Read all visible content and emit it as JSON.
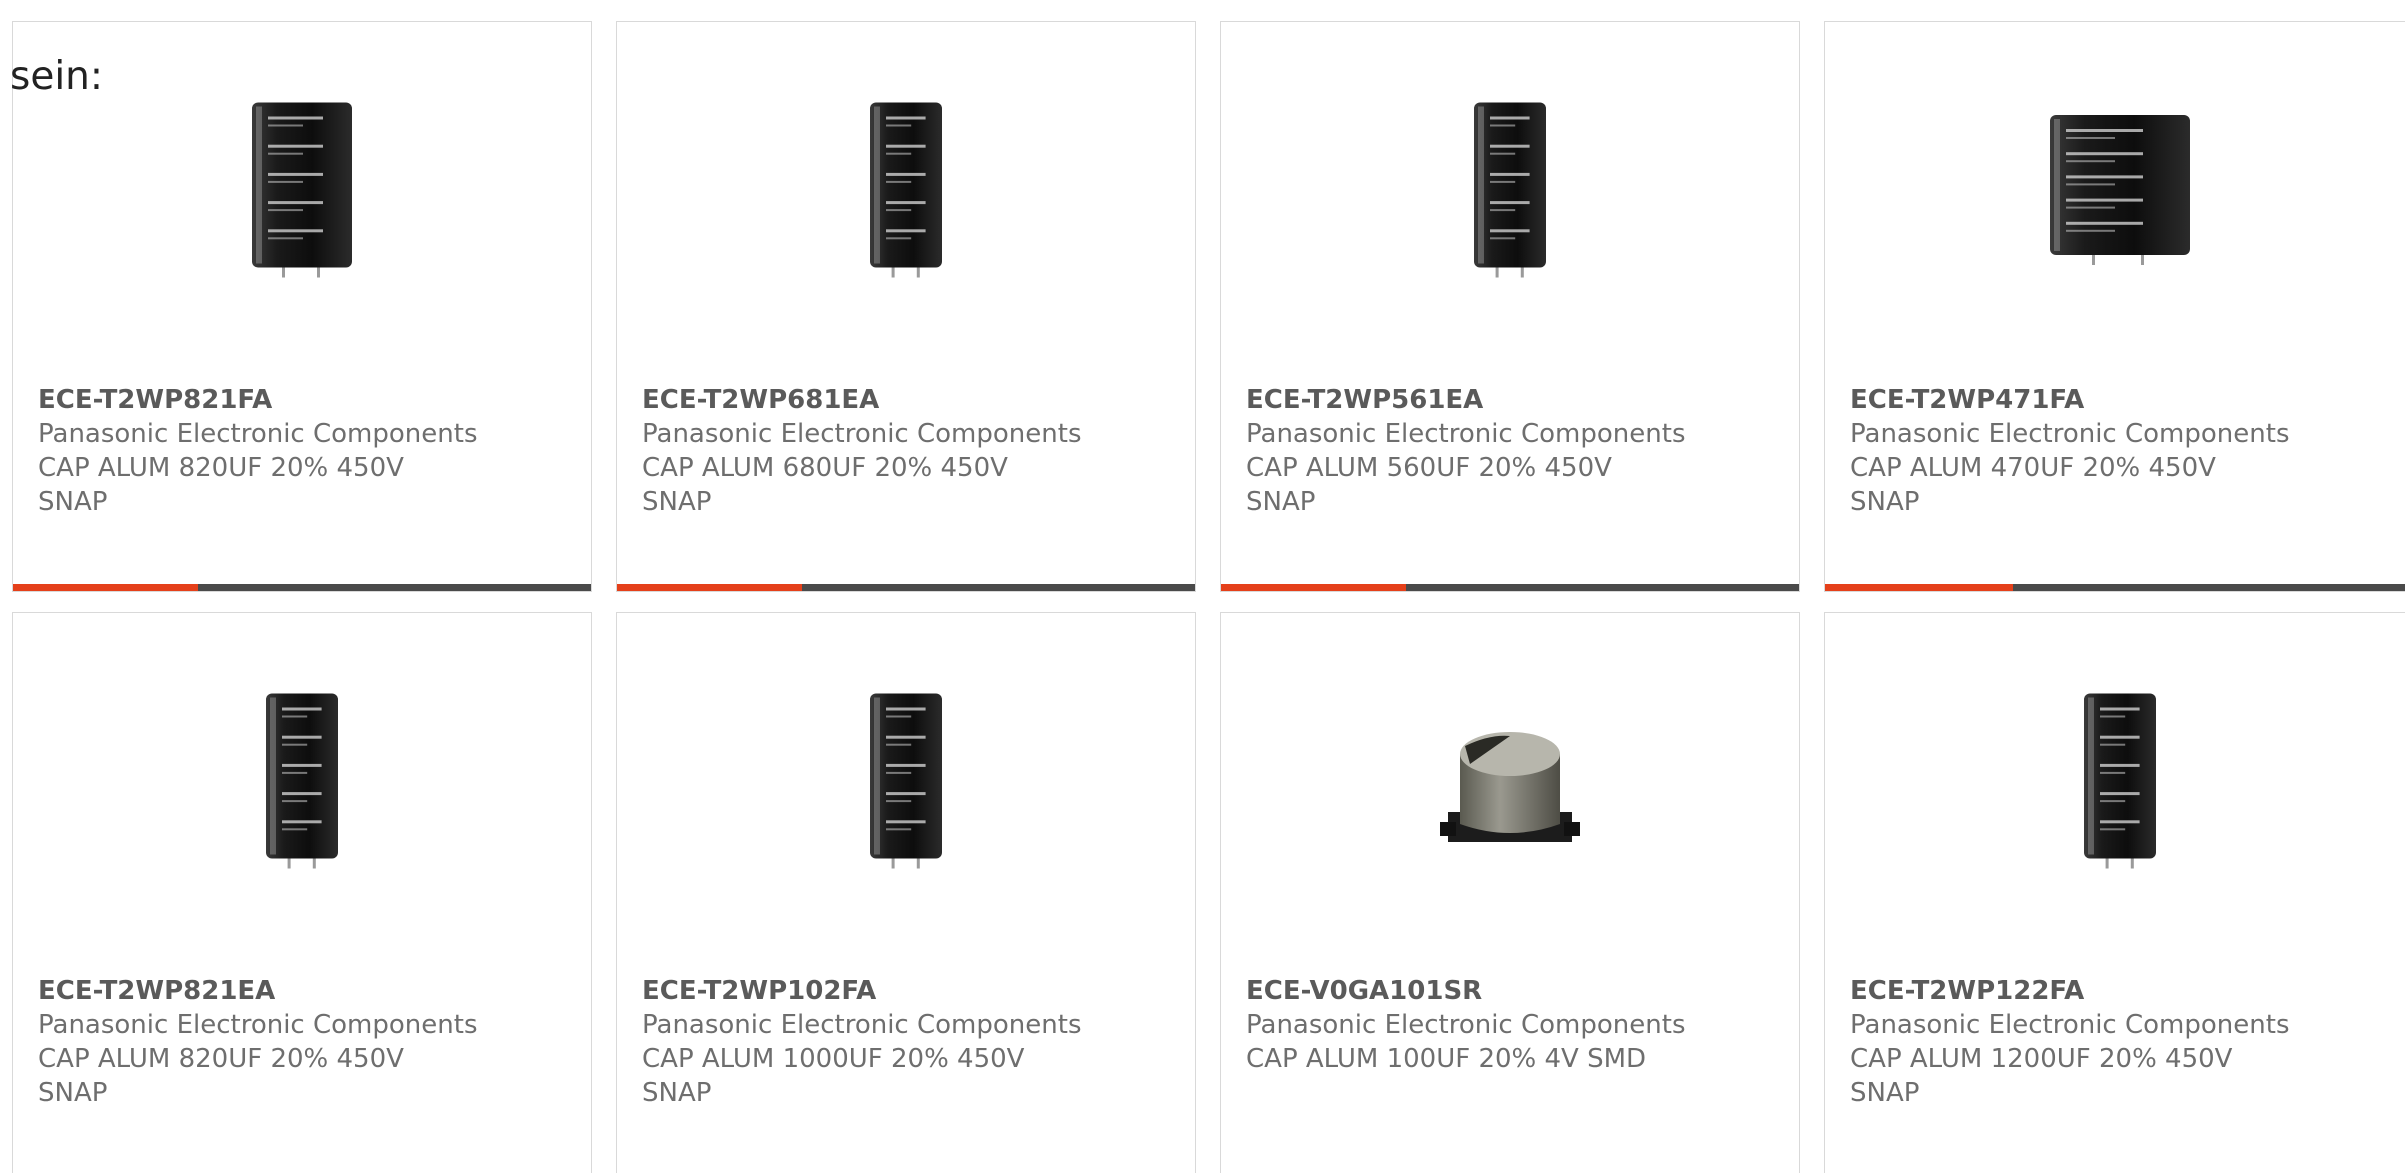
{
  "intro_text": "sein:",
  "colors": {
    "accent": "#e5401a",
    "bar": "#4a4a4a",
    "border": "#d9d9d9",
    "text": "#6e6e6e"
  },
  "products": [
    {
      "part_number": "ECE-T2WP821FA",
      "manufacturer": "Panasonic Electronic Components",
      "description": "CAP ALUM 820UF 20% 450V SNAP",
      "image": "snap-in-capacitor-wide",
      "progress_fraction": 0.32
    },
    {
      "part_number": "ECE-T2WP681EA",
      "manufacturer": "Panasonic Electronic Components",
      "description": "CAP ALUM 680UF 20% 450V SNAP",
      "image": "snap-in-capacitor-tall",
      "progress_fraction": 0.32
    },
    {
      "part_number": "ECE-T2WP561EA",
      "manufacturer": "Panasonic Electronic Components",
      "description": "CAP ALUM 560UF 20% 450V SNAP",
      "image": "snap-in-capacitor-tall",
      "progress_fraction": 0.32
    },
    {
      "part_number": "ECE-T2WP471FA",
      "manufacturer": "Panasonic Electronic Components",
      "description": "CAP ALUM 470UF 20% 450V SNAP",
      "image": "snap-in-capacitor-squat",
      "progress_fraction": 0.32
    },
    {
      "part_number": "ECE-T2WP821EA",
      "manufacturer": "Panasonic Electronic Components",
      "description": "CAP ALUM 820UF 20% 450V SNAP",
      "image": "snap-in-capacitor-tall"
    },
    {
      "part_number": "ECE-T2WP102FA",
      "manufacturer": "Panasonic Electronic Components",
      "description": "CAP ALUM 1000UF 20% 450V SNAP",
      "image": "snap-in-capacitor-tall"
    },
    {
      "part_number": "ECE-V0GA101SR",
      "manufacturer": "Panasonic Electronic Components",
      "description": "CAP ALUM 100UF 20% 4V SMD",
      "image": "smd-capacitor"
    },
    {
      "part_number": "ECE-T2WP122FA",
      "manufacturer": "Panasonic Electronic Components",
      "description": "CAP ALUM 1200UF 20% 450V SNAP",
      "image": "snap-in-capacitor-tall"
    }
  ]
}
